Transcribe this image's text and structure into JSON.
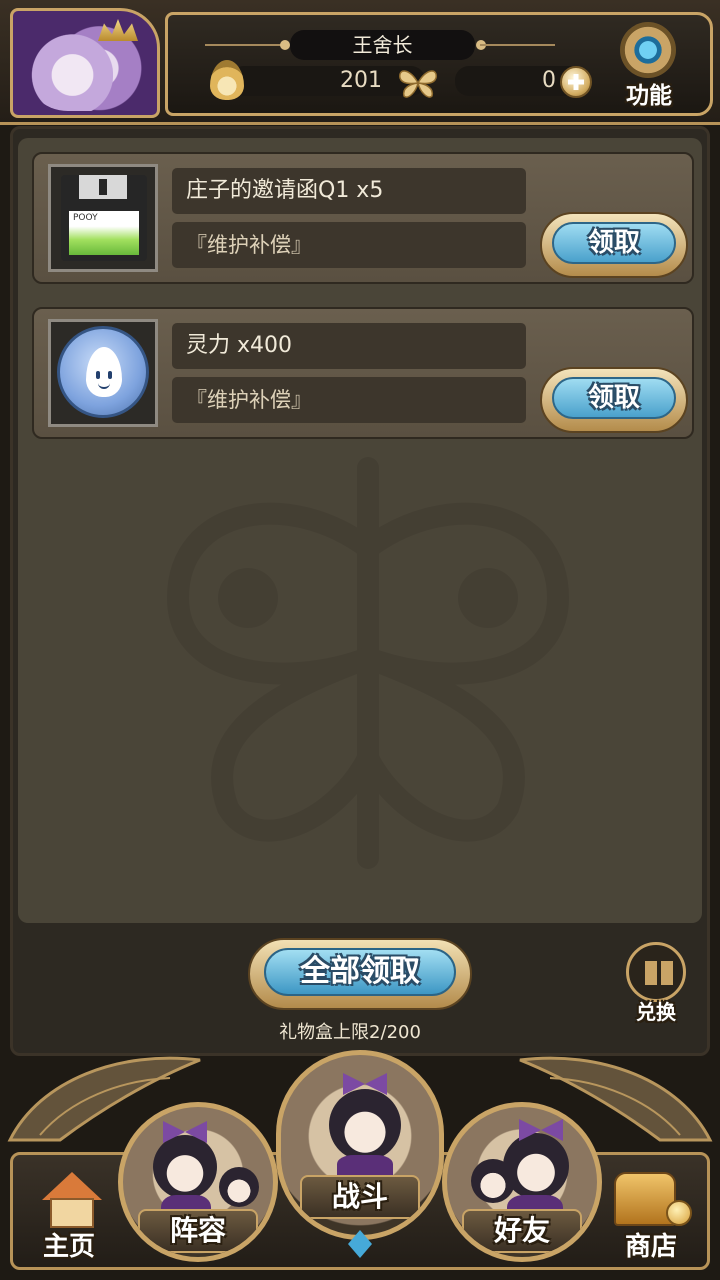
{
  "player": {
    "name": "王舍长",
    "spirit_value": "201",
    "gem_value": "0"
  },
  "header": {
    "menu_label": "功能"
  },
  "gifts": [
    {
      "name": "庄子的邀请函Q1 x5",
      "source": "『维护补偿』",
      "claim_label": "领取",
      "icon": "floppy-disk-icon",
      "floppy_text": "POOY"
    },
    {
      "name": "灵力 x400",
      "source": "『维护补偿』",
      "claim_label": "领取",
      "icon": "spirit-coin-icon"
    }
  ],
  "actions": {
    "claim_all_label": "全部领取",
    "capacity_text": "礼物盒上限2/200",
    "exchange_label": "兑换"
  },
  "nav": {
    "home": "主页",
    "team": "阵容",
    "battle": "战斗",
    "friends": "好友",
    "shop": "商店"
  },
  "colors": {
    "accent_gold": "#c9a466",
    "button_blue": "#4aa1cc",
    "panel_bg": "#4a4538"
  }
}
